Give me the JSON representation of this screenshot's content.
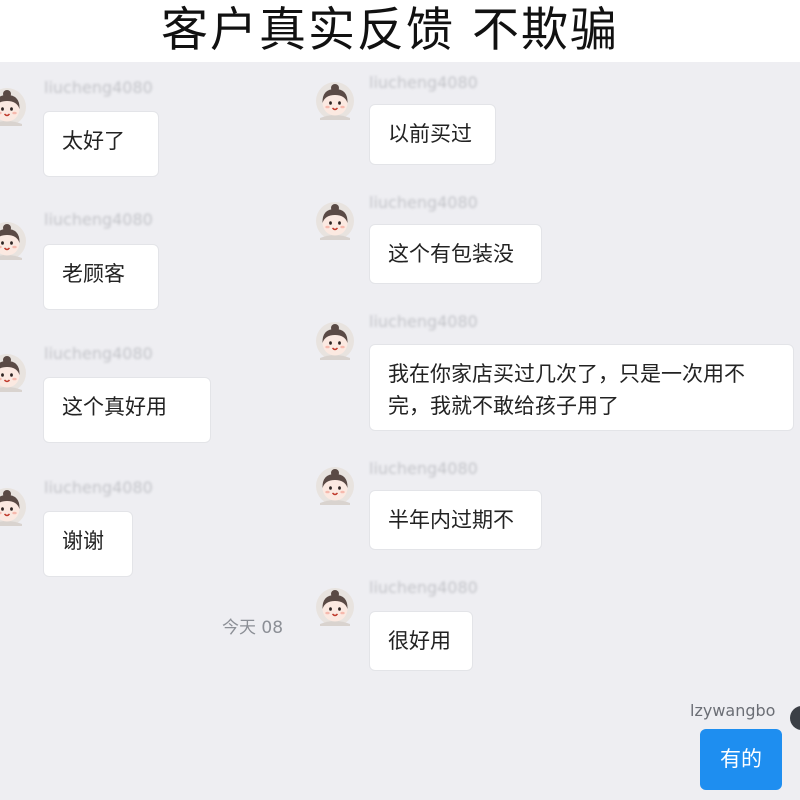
{
  "banner": {
    "title": "客户真实反馈 不欺骗"
  },
  "chat": {
    "timestamp": "今天 08",
    "left_column": [
      {
        "username": "liucheng4080",
        "message": "太好了"
      },
      {
        "username": "liucheng4080",
        "message": "老顾客"
      },
      {
        "username": "liucheng4080",
        "message": "这个真好用"
      },
      {
        "username": "liucheng4080",
        "message": "谢谢"
      }
    ],
    "right_column": [
      {
        "username": "liucheng4080",
        "message": "以前买过"
      },
      {
        "username": "liucheng4080",
        "message": "这个有包装没"
      },
      {
        "username": "liucheng4080",
        "message": "我在你家店买过几次了，只是一次用不完，我就不敢给孩子用了"
      },
      {
        "username": "liucheng4080",
        "message": "半年内过期不"
      },
      {
        "username": "liucheng4080",
        "message": "很好用"
      }
    ],
    "own": {
      "username": "lzywangbo",
      "message": "有的"
    }
  },
  "colors": {
    "panel_bg": "#eeeef2",
    "bubble_bg": "#ffffff",
    "own_bubble_bg": "#1e8ef0",
    "username_text": "#c3c4c9"
  },
  "icons": {
    "avatar": "cartoon-girl-avatar-icon"
  }
}
